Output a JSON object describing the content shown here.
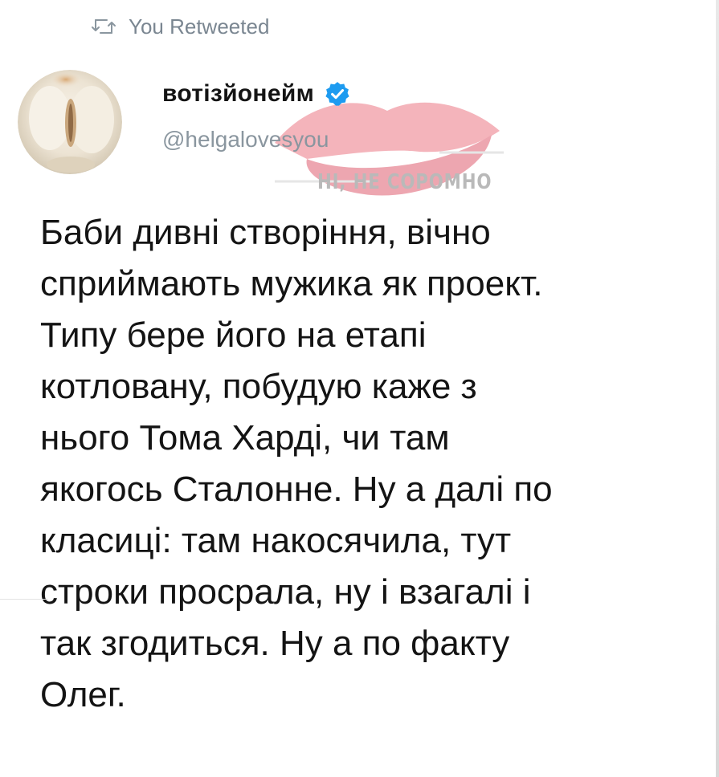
{
  "retweet": {
    "icon": "retweet-icon",
    "label": "You Retweeted"
  },
  "author": {
    "display_name": "вотізйонейм",
    "handle": "@helgalovesyou",
    "verified": true,
    "verified_icon": "verified-badge-icon",
    "verified_color": "#1d9bf0"
  },
  "watermark": {
    "text": "НІ, НЕ СОРОМНО"
  },
  "tweet": {
    "lines": [
      "Баби дивні створіння, вічно",
      "сприймають мужика як проект.",
      "Типу бере його на етапі",
      "котловану, побудую каже з",
      "нього Тома Харді, чи там",
      "якогось Сталонне. Ну а далі по",
      "класиці: там накосячила, тут",
      "строки просрала, ну і взагалі і",
      "так згодиться. Ну а по факту",
      "Олег."
    ]
  },
  "colors": {
    "secondary_text": "#8a969f",
    "primary_text": "#141414",
    "watermark": "#b9b9b9"
  }
}
